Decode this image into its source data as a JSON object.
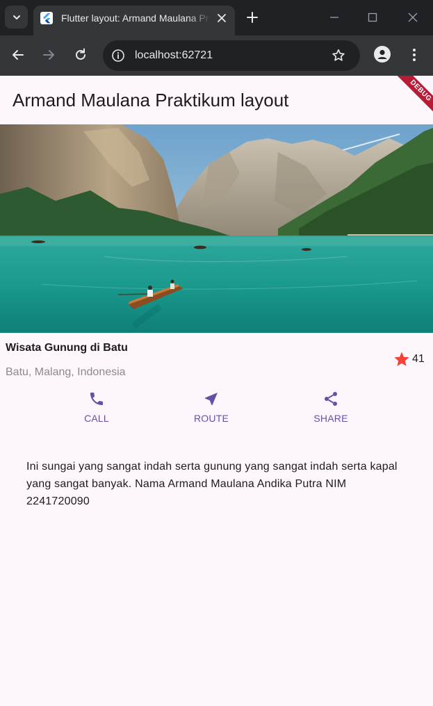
{
  "browser": {
    "tab_title": "Flutter layout: Armand Maulana Praktikum layout",
    "url": "localhost:62721",
    "tab_search_icon": "chevron-down-icon",
    "new_tab_icon": "plus-icon"
  },
  "app": {
    "title": "Armand Maulana Praktikum layout",
    "debug_banner": "DEBUG",
    "hero_image": "mountain-lake-photo",
    "place": {
      "name": "Wisata Gunung di Batu",
      "location": "Batu, Malang, Indonesia",
      "rating": "41",
      "star_color": "#f44336"
    },
    "actions": [
      {
        "label": "CALL",
        "icon": "phone-icon"
      },
      {
        "label": "ROUTE",
        "icon": "navigation-icon"
      },
      {
        "label": "SHARE",
        "icon": "share-icon"
      }
    ],
    "description": "Ini sungai yang sangat indah serta gunung yang sangat indah serta kapal yang sangat banyak. Nama Armand Maulana Andika Putra NIM 2241720090",
    "accent_color": "#6750a4"
  }
}
